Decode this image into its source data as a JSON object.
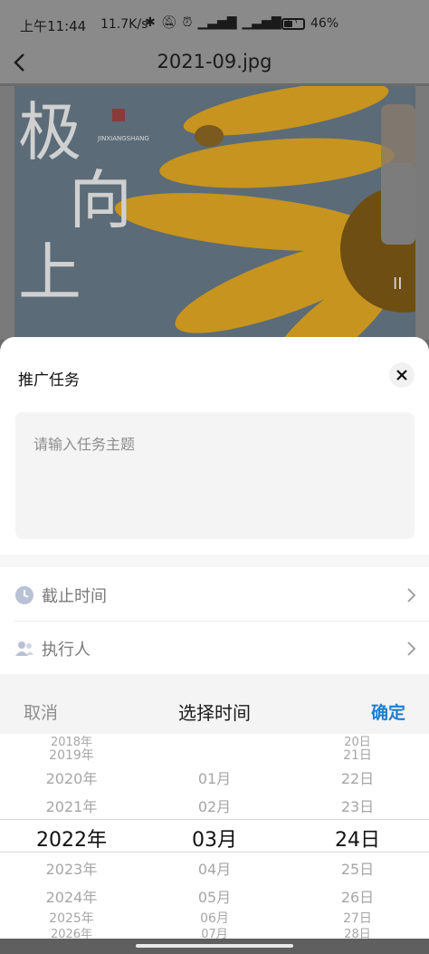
{
  "status_bar": {
    "time": "上午11:44",
    "net_speed": "11.7K/s",
    "battery": "46%",
    "battery_level": 0.46
  },
  "app_bar": {
    "title": "2021-09.jpg",
    "back_icon": "back-arrow-icon"
  },
  "photo": {
    "poster_text": "极 向 上",
    "small_caption": "JINXIANGSHANG",
    "brand_text": "II"
  },
  "sheet": {
    "title": "推广任务",
    "close_icon": "close-icon",
    "topic_placeholder": "请输入任务主题",
    "rows": [
      {
        "label": "截止时间",
        "icon": "clock-icon"
      },
      {
        "label": "执行人",
        "icon": "people-icon"
      }
    ]
  },
  "picker": {
    "cancel_label": "取消",
    "title": "选择时间",
    "confirm_label": "确定",
    "columns": {
      "year": {
        "items": [
          "2018年",
          "2019年",
          "2020年",
          "2021年",
          "2022年",
          "2023年",
          "2024年",
          "2025年",
          "2026年"
        ],
        "selected": "2022年"
      },
      "month": {
        "items": [
          "01月",
          "02月",
          "03月",
          "04月",
          "05月",
          "06月",
          "07月"
        ],
        "selected": "03月"
      },
      "day": {
        "items": [
          "20日",
          "21日",
          "22日",
          "23日",
          "24日",
          "25日",
          "26日",
          "27日",
          "28日"
        ],
        "selected": "24日"
      }
    }
  },
  "colors": {
    "accent": "#1f7fd0",
    "status_bar_bg": "#8a8a8a",
    "sheet_bg": "#ffffff"
  }
}
